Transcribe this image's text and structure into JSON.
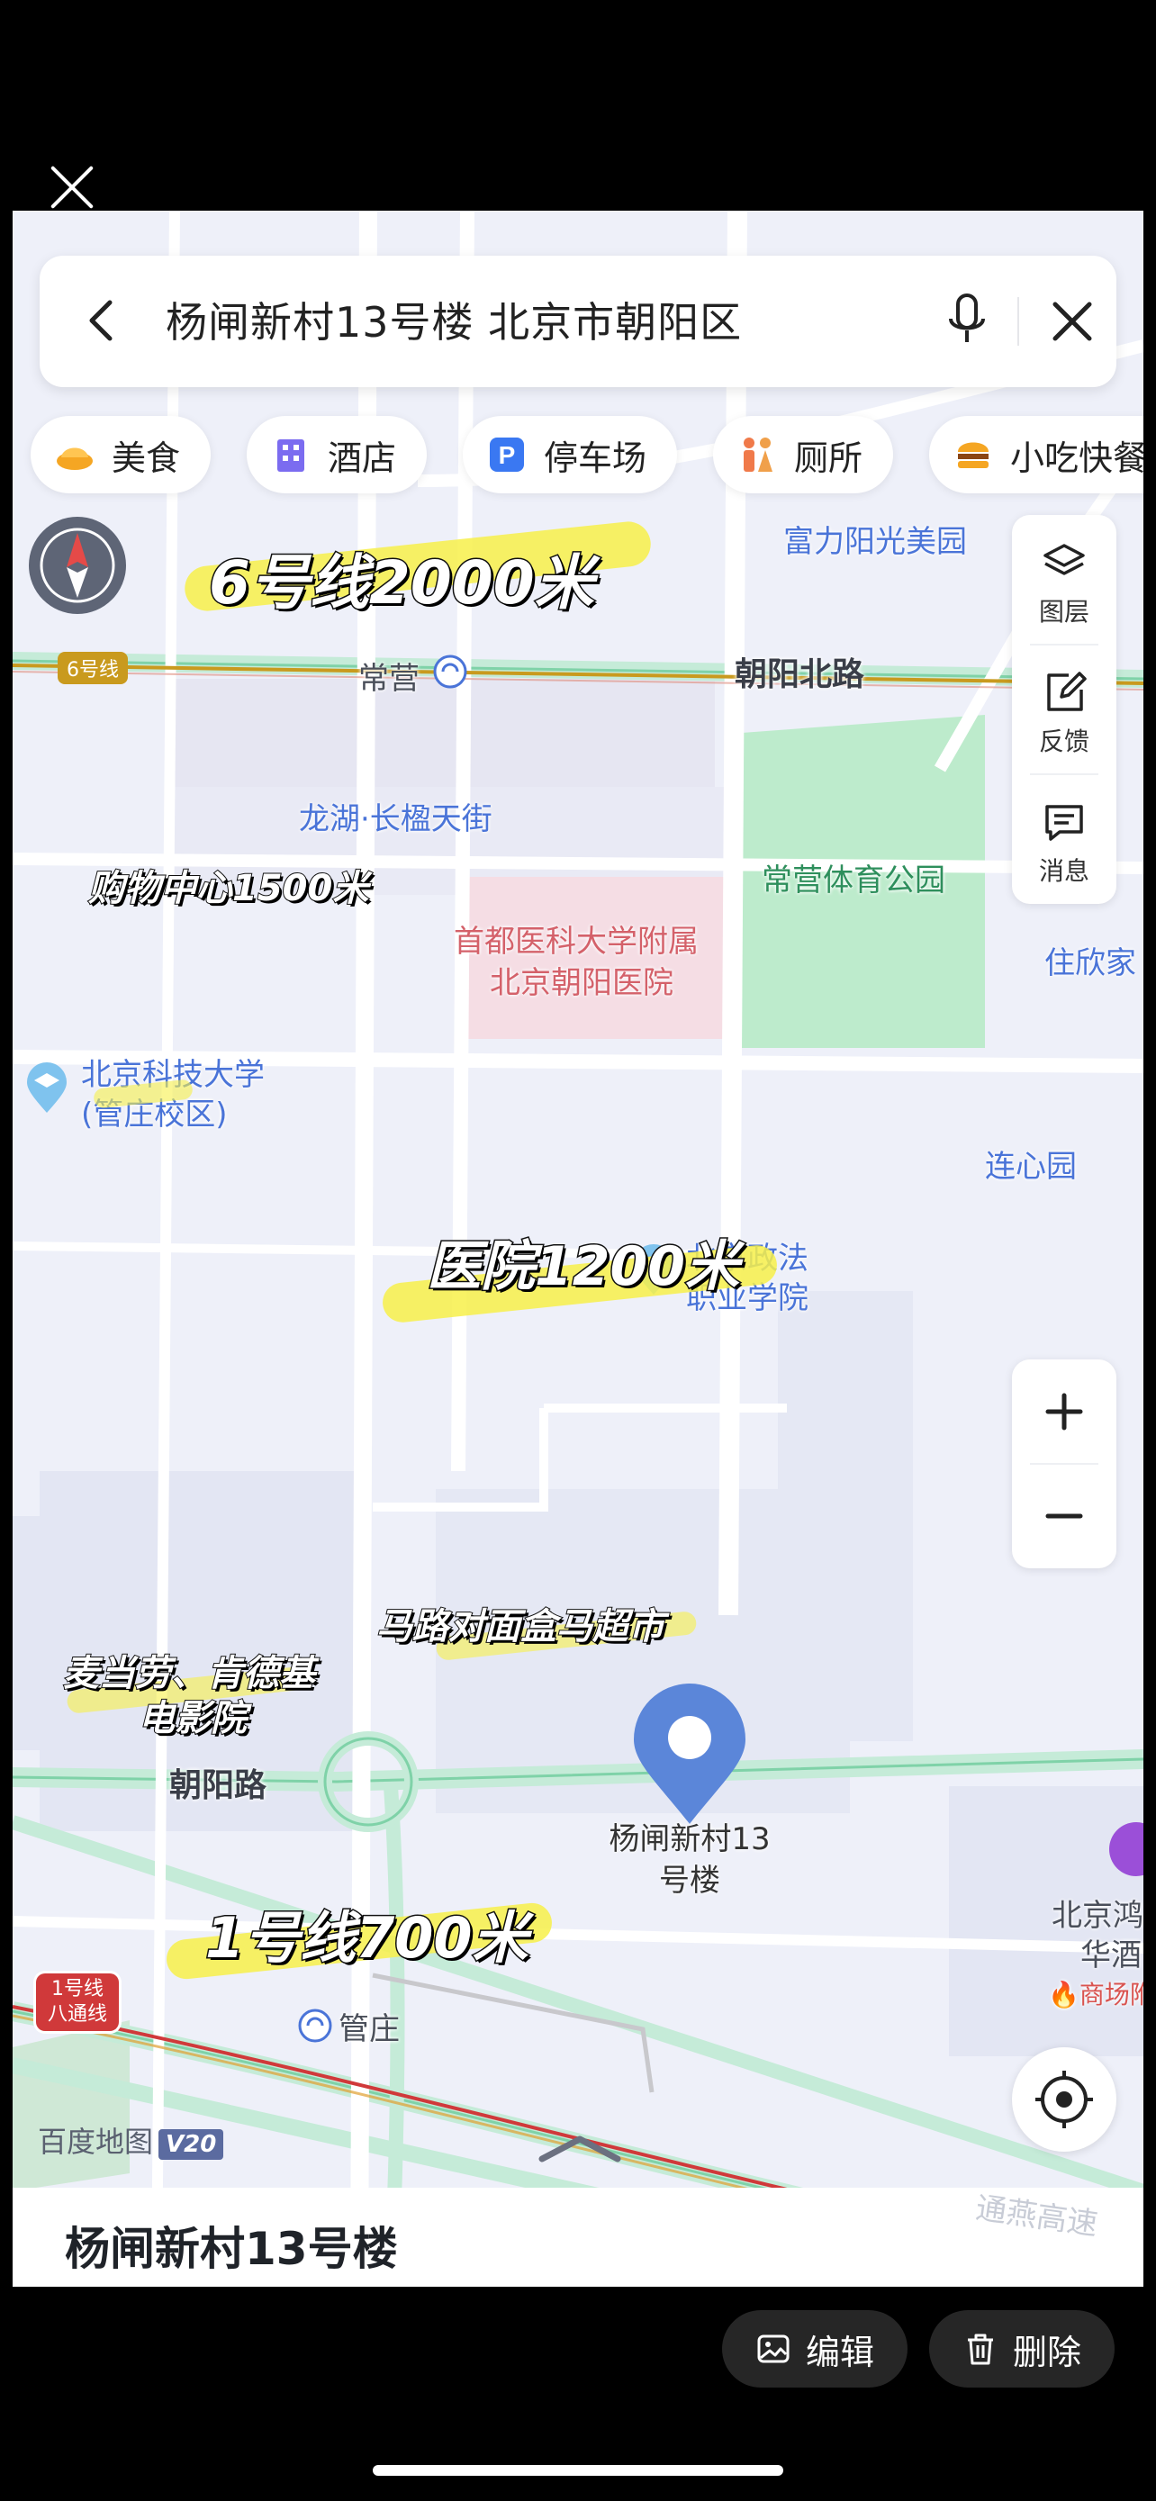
{
  "viewer": {
    "actions": {
      "edit_label": "编辑",
      "delete_label": "删除"
    }
  },
  "search": {
    "query": "杨闸新村13号楼 北京市朝阳区"
  },
  "categories": [
    {
      "label": "美食",
      "icon": "food-icon"
    },
    {
      "label": "酒店",
      "icon": "hotel-icon"
    },
    {
      "label": "停车场",
      "icon": "parking-icon"
    },
    {
      "label": "厕所",
      "icon": "toilet-icon"
    },
    {
      "label": "小吃快餐",
      "icon": "snack-icon"
    }
  ],
  "tools": [
    {
      "label": "图层",
      "icon": "layers-icon"
    },
    {
      "label": "反馈",
      "icon": "feedback-icon"
    },
    {
      "label": "消息",
      "icon": "message-icon"
    }
  ],
  "map": {
    "places": {
      "fuli": "富力阳光美园",
      "changying": "常营",
      "longhu": "龙湖·长楹天街",
      "park": "常营体育公园",
      "hospital_line1": "首都医科大学附属",
      "hospital_line2": "北京朝阳医院",
      "zhuxin": "住欣家",
      "ustb_line1": "北京科技大学",
      "ustb_line2": "(管庄校区)",
      "lianxin": "连心园",
      "zhengfa_line1": "北京政法",
      "zhengfa_line2": "职业学院",
      "guanzhuang": "管庄",
      "hotel_line1": "北京鸿",
      "hotel_line2": "华酒",
      "mall_tag": "商场附"
    },
    "roads": {
      "chaoyang_north": "朝阳北路",
      "chaoyang": "朝阳路",
      "tongyan": "通燕高速"
    },
    "line_badges": {
      "line6": "6号线",
      "line1_a": "1号线",
      "line1_b": "八通线"
    },
    "pin": {
      "line1": "杨闸新村13",
      "line2": "号楼"
    },
    "logo": "百度地图",
    "logo_version": "V20"
  },
  "annotations": {
    "line6": "6号线2000米",
    "mall": "购物中心1500米",
    "hospital": "医院1200米",
    "hema": "马路对面盒马超市",
    "mcd_line1": "麦当劳、肯德基",
    "mcd_line2": "电影院",
    "line1": "1号线700米"
  },
  "sheet": {
    "title": "杨闸新村13号楼"
  },
  "colors": {
    "accent": "#3a78f2",
    "pin": "#5b86d9",
    "highlight": "#f7f04a",
    "subway_line6": "#c99a1e",
    "subway_line1": "#d0393a",
    "park": "#bdebcc"
  }
}
